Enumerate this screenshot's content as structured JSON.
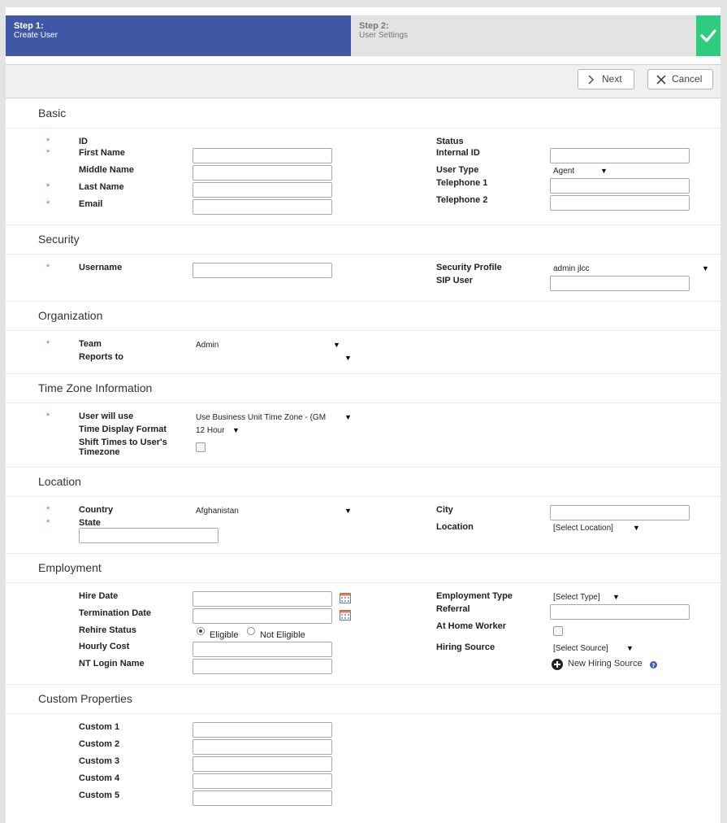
{
  "wizard": {
    "step1_title": "Step 1:",
    "step1_sub": "Create User",
    "step2_title": "Step 2:",
    "step2_sub": "User Settings"
  },
  "toolbar": {
    "next_label": "Next",
    "cancel_label": "Cancel"
  },
  "basic": {
    "title": "Basic",
    "id": "ID",
    "first_name": "First Name",
    "middle_name": "Middle Name",
    "last_name": "Last Name",
    "email": "Email",
    "status": "Status",
    "internal_id": "Internal ID",
    "user_type": "User Type",
    "user_type_value": "Agent",
    "telephone1": "Telephone 1",
    "telephone2": "Telephone 2"
  },
  "security": {
    "title": "Security",
    "username": "Username",
    "security_profile": "Security Profile",
    "security_profile_value": "admin jlcc",
    "sip_user": "SIP User"
  },
  "organization": {
    "title": "Organization",
    "team": "Team",
    "team_value": "Admin",
    "reports_to": "Reports to"
  },
  "timezone": {
    "title": "Time Zone Information",
    "user_will_use": "User will use",
    "user_will_use_value": "Use Business Unit Time Zone - (GM",
    "display_format": "Time Display Format",
    "display_format_value": "12 Hour",
    "shift_times_1": "Shift Times to User's",
    "shift_times_2": "Timezone"
  },
  "location": {
    "title": "Location",
    "country": "Country",
    "country_value": "Afghanistan",
    "state": "State",
    "city": "City",
    "location": "Location",
    "location_value": "[Select Location]"
  },
  "employment": {
    "title": "Employment",
    "hire_date": "Hire Date",
    "termination_date": "Termination Date",
    "rehire_status": "Rehire Status",
    "eligible": "Eligible",
    "not_eligible": "Not Eligible",
    "hourly_cost": "Hourly Cost",
    "nt_login": "NT Login Name",
    "employment_type": "Employment Type",
    "employment_type_value": "[Select Type]",
    "referral": "Referral",
    "at_home_worker": "At Home Worker",
    "hiring_source": "Hiring Source",
    "hiring_source_value": "[Select Source]",
    "new_hiring_source": "New Hiring Source"
  },
  "custom": {
    "title": "Custom Properties",
    "c1": "Custom 1",
    "c2": "Custom 2",
    "c3": "Custom 3",
    "c4": "Custom 4",
    "c5": "Custom 5"
  },
  "colors": {
    "step_active": "#3f58a6",
    "step_done": "#2dcc7f",
    "required": "#e8582f"
  },
  "icons": {
    "next": "chevron-right-icon",
    "cancel": "close-icon",
    "done": "checkmark-icon",
    "calendar": "calendar-icon",
    "add": "plus-circle-icon",
    "help": "help-icon"
  }
}
